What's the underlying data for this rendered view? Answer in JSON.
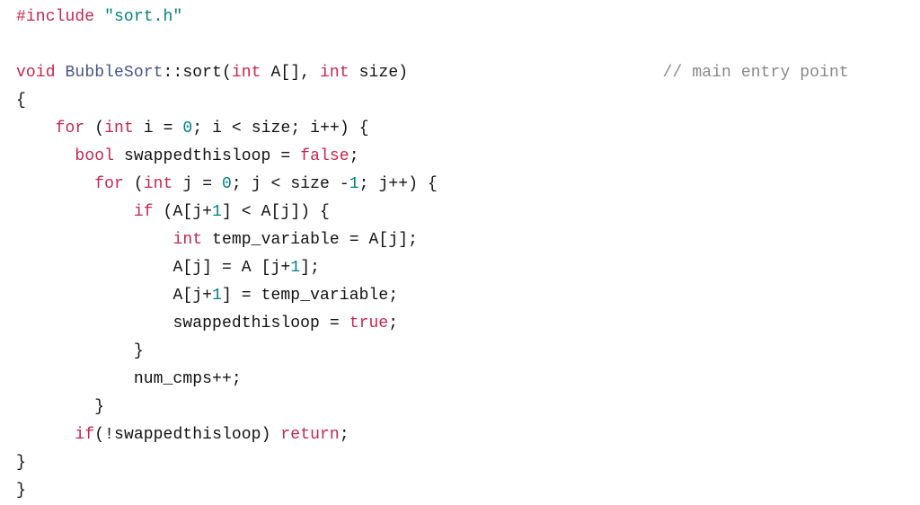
{
  "code": {
    "line1": {
      "hash": "#include",
      "hdr": "\"sort.h\""
    },
    "line2": {
      "kw_void": "void",
      "cls": "BubbleSort",
      "scope": "::",
      "fn": "sort",
      "paren_open": "(",
      "kw_int1": "int",
      "arr": "A[]",
      "comma": ",",
      "kw_int2": "int",
      "sz": "size",
      "paren_close": ")",
      "comment": "// main entry point"
    },
    "line3": {
      "brace": "{"
    },
    "line4": {
      "kw_for": "for",
      "open": "(",
      "kw_int": "int",
      "var_i": "i",
      "eq": "=",
      "zero": "0",
      "semi1": ";",
      "i2": "i",
      "lt": "<",
      "size": "size",
      "semi2": ";",
      "i3": "i",
      "inc": "++",
      "close": ")",
      "brace": "{"
    },
    "line5": {
      "kw_bool": "bool",
      "var": "swappedthisloop",
      "eq": "=",
      "val": "false",
      "semi": ";"
    },
    "line6": {
      "kw_for": "for",
      "open": "(",
      "kw_int": "int",
      "var_j": "j",
      "eq": "=",
      "zero": "0",
      "semi1": ";",
      "j2": "j",
      "lt": "<",
      "size": "size",
      "minus": "-",
      "one": "1",
      "semi2": ";",
      "j3": "j",
      "inc": "++",
      "close": ")",
      "brace": "{"
    },
    "line7": {
      "kw_if": "if",
      "open": "(",
      "a1": "A",
      "lb1": "[",
      "j1": "j",
      "plus": "+",
      "one": "1",
      "rb1": "]",
      "lt": "<",
      "a2": "A",
      "lb2": "[",
      "j2": "j",
      "rb2": "]",
      "close": ")",
      "brace": "{"
    },
    "line8": {
      "kw_int": "int",
      "temp": "temp_variable",
      "eq": "=",
      "a": "A",
      "lb": "[",
      "j": "j",
      "rb": "]",
      "semi": ";"
    },
    "line9": {
      "a1": "A",
      "lb1": "[",
      "j1": "j",
      "rb1": "]",
      "eq": "=",
      "a2": "A",
      "lb2": "[",
      "j2": "j",
      "plus": "+",
      "one": "1",
      "rb2": "]",
      "semi": ";"
    },
    "line10": {
      "a": "A",
      "lb": "[",
      "j": "j",
      "plus": "+",
      "one": "1",
      "rb": "]",
      "eq": "=",
      "temp": "temp_variable",
      "semi": ";"
    },
    "line11": {
      "var": "swappedthisloop",
      "eq": "=",
      "val": "true",
      "semi": ";"
    },
    "line12": {
      "brace": "}"
    },
    "line13": {
      "var": "num_cmps",
      "inc": "++",
      "semi": ";"
    },
    "line14": {
      "brace": "}"
    },
    "line15": {
      "kw_if": "if",
      "open": "(",
      "bang": "!",
      "var": "swappedthisloop",
      "close": ")",
      "kw_return": "return",
      "semi": ";"
    },
    "line16": {
      "brace": "}"
    },
    "line17": {
      "brace": "}"
    }
  }
}
